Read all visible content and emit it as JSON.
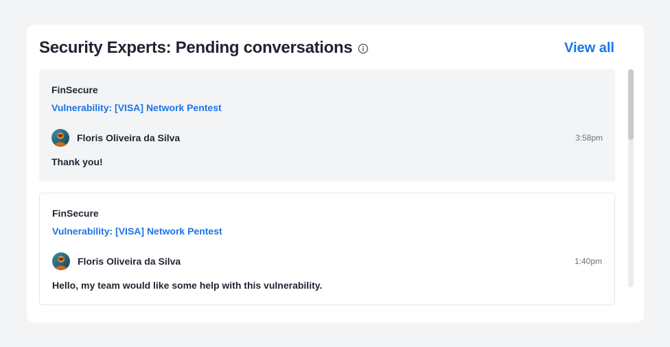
{
  "header": {
    "title": "Security Experts: Pending conversations",
    "info_icon": "info-icon",
    "view_all_label": "View all"
  },
  "colors": {
    "accent": "#1a73e8",
    "active_bg": "#f3f4f6",
    "text": "#1f2430",
    "muted": "#6b7280"
  },
  "conversations": [
    {
      "organization": "FinSecure",
      "subject": "Vulnerability: [VISA] Network Pentest",
      "author": "Floris Oliveira da Silva",
      "avatar_icon": "user-avatar",
      "time": "3:58pm",
      "message": "Thank you!",
      "active": true
    },
    {
      "organization": "FinSecure",
      "subject": "Vulnerability: [VISA] Network Pentest",
      "author": "Floris Oliveira da Silva",
      "avatar_icon": "user-avatar",
      "time": "1:40pm",
      "message": "Hello, my team would like some help with this vulnerability.",
      "active": false
    }
  ]
}
